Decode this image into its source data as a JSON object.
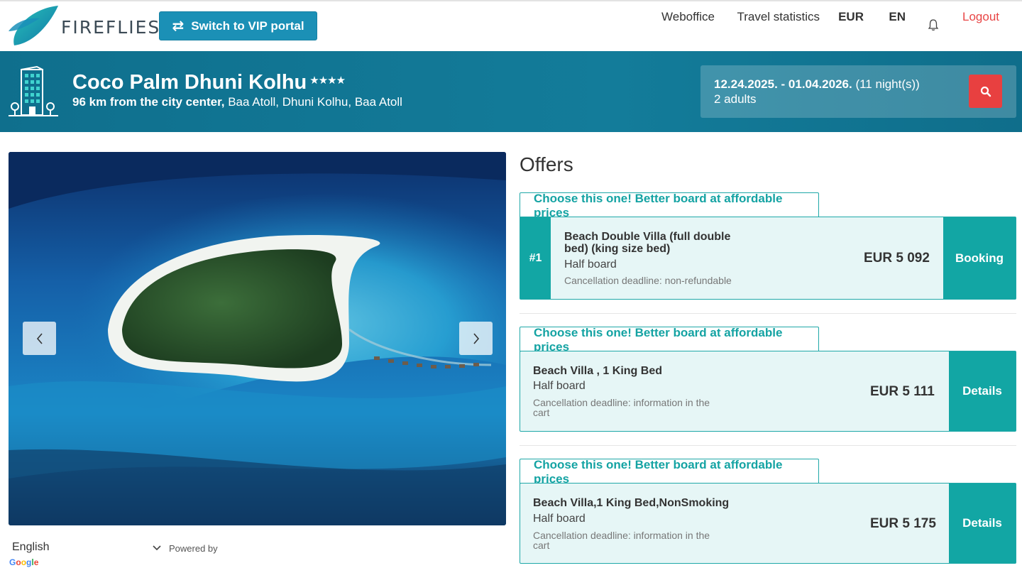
{
  "brand": {
    "name": "FIREFLIES"
  },
  "topbar": {
    "vip_label": "Switch to VIP portal",
    "nav": {
      "weboffice": "Weboffice",
      "travel_statistics": "Travel statistics",
      "currency": "EUR",
      "language": "EN",
      "logout": "Logout"
    }
  },
  "hotel": {
    "name": "Coco Palm Dhuni Kolhu",
    "stars": "★★★★",
    "distance": "96 km from the city center,",
    "location": " Baa Atoll, Dhuni Kolhu, Baa Atoll"
  },
  "search": {
    "dates": "12.24.2025. - 01.04.2026.",
    "nights": " (11 night(s))",
    "guests": "2 adults"
  },
  "language_bar": {
    "selected": "English",
    "powered_by": "Powered by",
    "google": "Google"
  },
  "offers": {
    "title": "Offers",
    "items": [
      {
        "tag": "Choose this one! Better board at affordable prices",
        "rank": "#1",
        "title_line1": "Beach Double Villa (full double",
        "title_line2": "bed) (king size bed)",
        "board": "Half board",
        "cancel_line1": "Cancellation deadline: non-refundable",
        "cancel_line2": "",
        "price": "EUR 5 092",
        "cta": "Booking"
      },
      {
        "tag": "Choose this one! Better board at affordable prices",
        "title_line1": "Beach Villa , 1 King Bed",
        "board": "Half board",
        "cancel_line1": "Cancellation deadline: information in the",
        "cancel_line2": "cart",
        "price": "EUR 5 111",
        "cta": "Details"
      },
      {
        "tag": "Choose this one! Better board at affordable prices",
        "title_line1": "Beach Villa,1 King Bed,NonSmoking",
        "board": "Half board",
        "cancel_line1": "Cancellation deadline: information in the",
        "cancel_line2": "cart",
        "price": "EUR 5 175",
        "cta": "Details"
      }
    ]
  },
  "colors": {
    "primary": "#1b90b6",
    "teal": "#12a6a4",
    "band": "#137c9a",
    "danger": "#e84040",
    "card_bg": "#e6f6f6"
  },
  "icons": [
    "swap-arrows-icon",
    "bell-icon",
    "building-icon",
    "search-icon",
    "chevron-left-icon",
    "chevron-right-icon",
    "chevron-down-icon"
  ]
}
